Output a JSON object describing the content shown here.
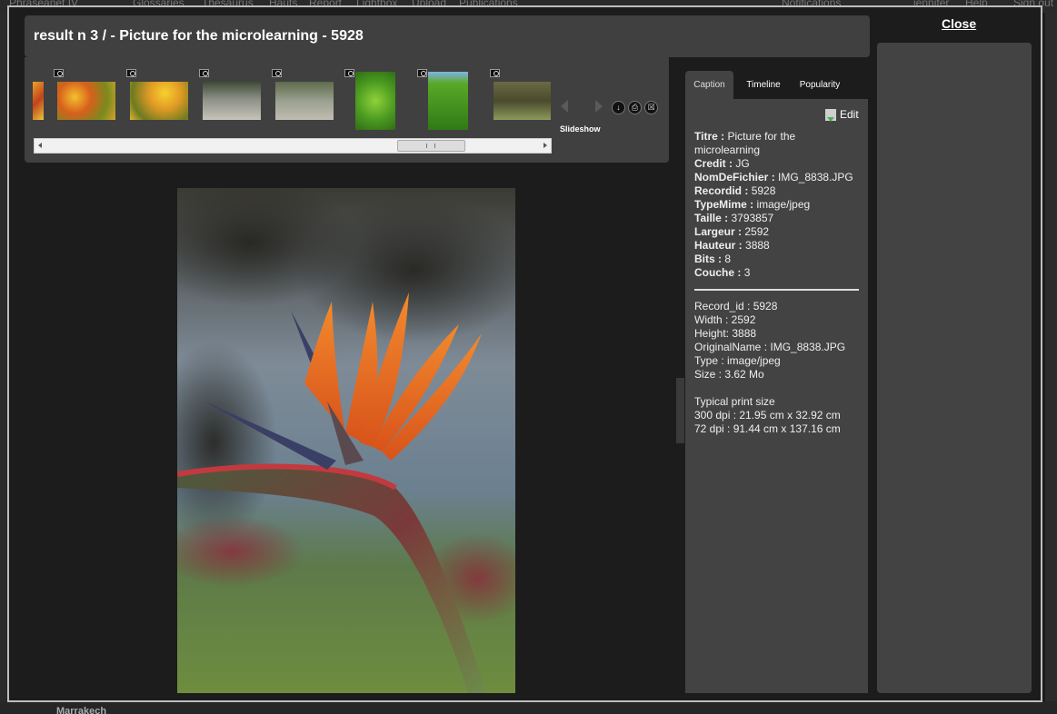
{
  "background": {
    "top_nav": [
      "Phraseanet IV",
      "Glossaries",
      "Thesaurus",
      "Hauts",
      "Report",
      "Lightbox",
      "Upload",
      "Publications",
      "Notifications",
      "jennifer",
      "Help",
      "Sign out"
    ],
    "bottom_label": "Marrakech"
  },
  "viewer": {
    "title": "result n 3 / - Picture for the microlearning - 5928",
    "close_label": "Close",
    "slideshow_label": "Slideshow",
    "thumbnails": [
      {
        "name": "flowers-orange-1"
      },
      {
        "name": "flowers-orange-2"
      },
      {
        "name": "flowers-yellow"
      },
      {
        "name": "pigeon-1"
      },
      {
        "name": "pigeon-2"
      },
      {
        "name": "tree-1"
      },
      {
        "name": "tree-2"
      },
      {
        "name": "bird-black"
      }
    ],
    "actions": [
      "download-icon",
      "print-icon",
      "basket-icon"
    ]
  },
  "caption": {
    "tabs": [
      "Caption",
      "Timeline",
      "Popularity"
    ],
    "active_tab": "Caption",
    "edit_label": "Edit",
    "fields": [
      {
        "key": "Titre",
        "value": "Picture for the"
      },
      {
        "key": "",
        "value": "microlearning"
      },
      {
        "key": "Credit",
        "value": "JG"
      },
      {
        "key": "NomDeFichier",
        "value": "IMG_8838.JPG"
      },
      {
        "key": "Recordid",
        "value": "5928"
      },
      {
        "key": "TypeMime",
        "value": "image/jpeg"
      },
      {
        "key": "Taille",
        "value": "3793857"
      },
      {
        "key": "Largeur",
        "value": "2592"
      },
      {
        "key": "Hauteur",
        "value": "3888"
      },
      {
        "key": "Bits",
        "value": "8"
      },
      {
        "key": "Couche",
        "value": "3"
      }
    ],
    "tech": [
      "Record_id : 5928",
      "Width : 2592",
      "Height: 3888",
      "OriginalName : IMG_8838.JPG",
      "Type : image/jpeg",
      "Size : 3.62 Mo"
    ],
    "print": [
      "Typical print size",
      "300 dpi : 21.95 cm x 32.92 cm",
      "72 dpi : 91.44 cm x 137.16 cm"
    ]
  },
  "colors": {
    "panel": "#404040",
    "caption_bg": "#434343",
    "accent_green": "#4caf50"
  }
}
